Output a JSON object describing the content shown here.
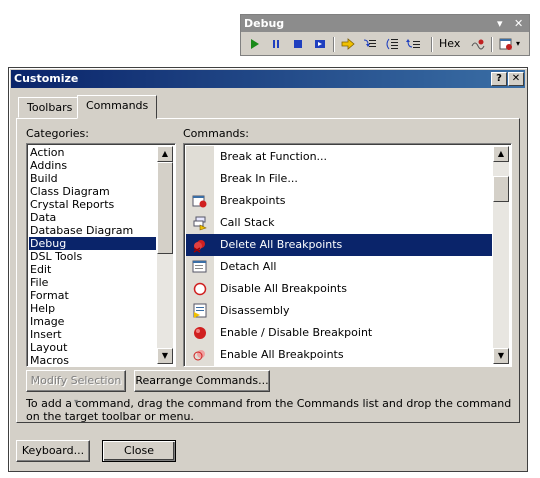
{
  "debug_toolbar": {
    "title": "Debug",
    "menu_glyph": "▾",
    "close_glyph": "✕",
    "hex_label": "Hex",
    "icons": [
      "start-icon",
      "break-all-icon",
      "stop-icon",
      "restart-icon",
      "show-next-statement-icon",
      "step-into-icon",
      "step-over-icon",
      "step-out-icon",
      "breakpoint-window-icon"
    ]
  },
  "dialog": {
    "title": "Customize",
    "help_glyph": "?",
    "close_glyph": "✕",
    "tabs": [
      {
        "label": "Toolbars",
        "active": false
      },
      {
        "label": "Commands",
        "active": true
      }
    ],
    "categories_label": "Categories:",
    "commands_label": "Commands:",
    "categories": [
      "Action",
      "Addins",
      "Build",
      "Class Diagram",
      "Crystal Reports",
      "Data",
      "Database Diagram",
      "Debug",
      "DSL Tools",
      "Edit",
      "File",
      "Format",
      "Help",
      "Image",
      "Insert",
      "Layout",
      "Macros"
    ],
    "selected_category": "Debug",
    "commands": [
      {
        "label": "Break at Function...",
        "icon": "none"
      },
      {
        "label": "Break In File...",
        "icon": "none"
      },
      {
        "label": "Breakpoints",
        "icon": "breakpoints-icon"
      },
      {
        "label": "Call Stack",
        "icon": "call-stack-icon"
      },
      {
        "label": "Delete All Breakpoints",
        "icon": "delete-breakpoints-icon"
      },
      {
        "label": "Detach All",
        "icon": "detach-all-icon"
      },
      {
        "label": "Disable All Breakpoints",
        "icon": "disable-breakpoints-icon"
      },
      {
        "label": "Disassembly",
        "icon": "disassembly-icon"
      },
      {
        "label": "Enable / Disable Breakpoint",
        "icon": "toggle-breakpoint-icon"
      },
      {
        "label": "Enable All Breakpoints",
        "icon": "enable-breakpoints-icon"
      }
    ],
    "selected_command": "Delete All Breakpoints",
    "modify_selection_label": "Modify Selection",
    "rearrange_label": "Rearrange Commands...",
    "help_text": "To add a command, drag the command from the Commands list and drop the command on the target toolbar or menu.",
    "keyboard_label": "Keyboard...",
    "close_label": "Close"
  },
  "colors": {
    "face": "#d4d0c8",
    "selection": "#0a246a",
    "title_gradient_start": "#0a246a",
    "title_gradient_end": "#3a6ea5"
  }
}
